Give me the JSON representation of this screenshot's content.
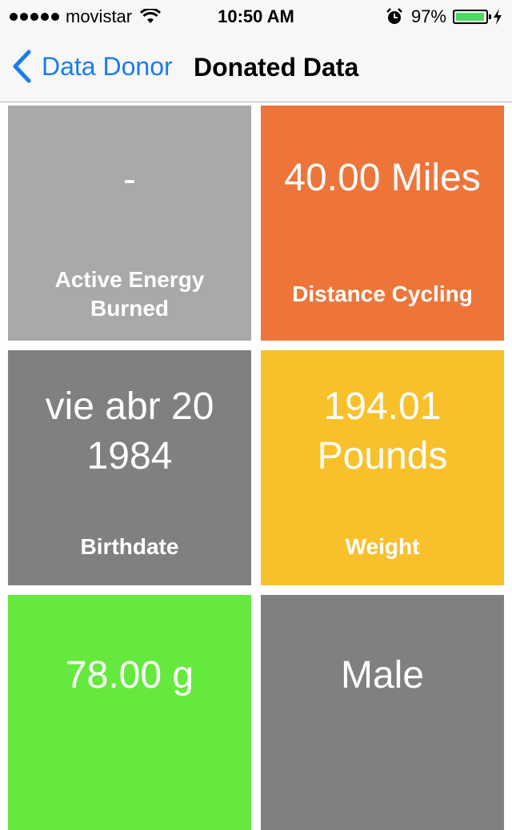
{
  "status_bar": {
    "carrier": "movistar",
    "time": "10:50 AM",
    "battery_percent": "97%",
    "battery_level": 0.97,
    "icons": [
      "signal-dots-icon",
      "wifi-icon",
      "alarm-icon",
      "battery-icon",
      "charging-bolt-icon"
    ]
  },
  "nav": {
    "back_label": "Data Donor",
    "title": "Donated Data",
    "accent_color": "#1a7cf3"
  },
  "tiles": [
    {
      "value": "-",
      "label": "Active Energy\nBurned",
      "color": "#a9a9a9"
    },
    {
      "value": "40.00 Miles",
      "label": "Distance Cycling",
      "color": "#ee753a"
    },
    {
      "value": "vie abr 20\n1984",
      "label": "Birthdate",
      "color": "#808080"
    },
    {
      "value": "194.01\nPounds",
      "label": "Weight",
      "color": "#f8c12c"
    },
    {
      "value": "78.00 g",
      "label": "",
      "color": "#66e93e"
    },
    {
      "value": "Male",
      "label": "",
      "color": "#808080"
    }
  ]
}
